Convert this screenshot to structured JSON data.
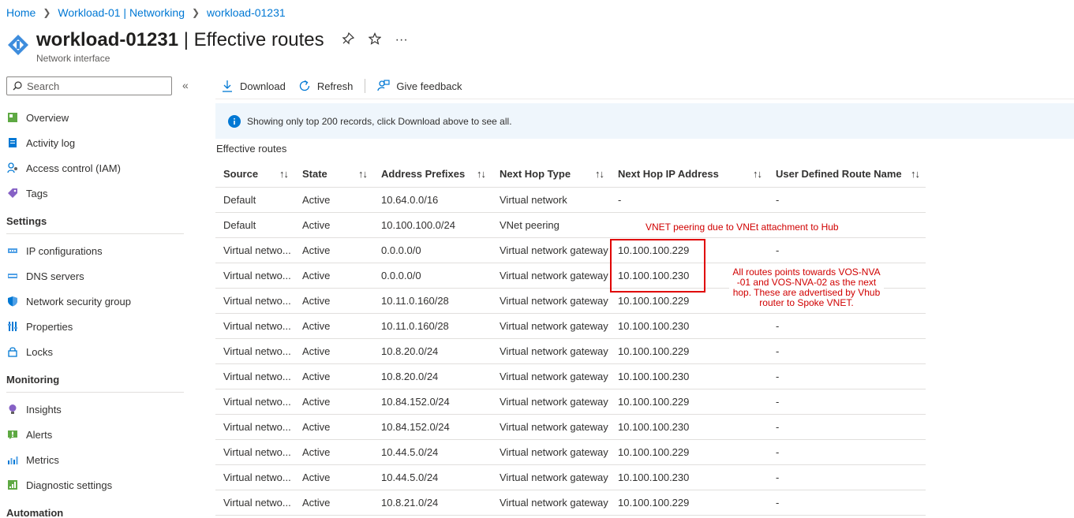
{
  "breadcrumb": {
    "items": [
      "Home",
      "Workload-01 | Networking",
      "workload-01231"
    ]
  },
  "header": {
    "name": "workload-01231",
    "separator": " | ",
    "section": "Effective routes",
    "subtitle": "Network interface"
  },
  "sidebar": {
    "search_placeholder": "Search",
    "items_top": [
      "Overview",
      "Activity log",
      "Access control (IAM)",
      "Tags"
    ],
    "settings_title": "Settings",
    "settings_items": [
      "IP configurations",
      "DNS servers",
      "Network security group",
      "Properties",
      "Locks"
    ],
    "monitoring_title": "Monitoring",
    "monitoring_items": [
      "Insights",
      "Alerts",
      "Metrics",
      "Diagnostic settings"
    ],
    "automation_title": "Automation"
  },
  "toolbar": {
    "download": "Download",
    "refresh": "Refresh",
    "feedback": "Give feedback"
  },
  "info": "Showing only top 200 records, click Download above to see all.",
  "section_label": "Effective routes",
  "table": {
    "headers": [
      "Source",
      "State",
      "Address Prefixes",
      "Next Hop Type",
      "Next Hop IP Address",
      "User Defined Route Name"
    ],
    "rows": [
      [
        "Default",
        "Active",
        "10.64.0.0/16",
        "Virtual network",
        "-",
        "-"
      ],
      [
        "Default",
        "Active",
        "10.100.100.0/24",
        "VNet peering",
        "",
        ""
      ],
      [
        "Virtual netwo...",
        "Active",
        "0.0.0.0/0",
        "Virtual network gateway",
        "10.100.100.229",
        "-"
      ],
      [
        "Virtual netwo...",
        "Active",
        "0.0.0.0/0",
        "Virtual network gateway",
        "10.100.100.230",
        ""
      ],
      [
        "Virtual netwo...",
        "Active",
        "10.11.0.160/28",
        "Virtual network gateway",
        "10.100.100.229",
        ""
      ],
      [
        "Virtual netwo...",
        "Active",
        "10.11.0.160/28",
        "Virtual network gateway",
        "10.100.100.230",
        "-"
      ],
      [
        "Virtual netwo...",
        "Active",
        "10.8.20.0/24",
        "Virtual network gateway",
        "10.100.100.229",
        "-"
      ],
      [
        "Virtual netwo...",
        "Active",
        "10.8.20.0/24",
        "Virtual network gateway",
        "10.100.100.230",
        "-"
      ],
      [
        "Virtual netwo...",
        "Active",
        "10.84.152.0/24",
        "Virtual network gateway",
        "10.100.100.229",
        "-"
      ],
      [
        "Virtual netwo...",
        "Active",
        "10.84.152.0/24",
        "Virtual network gateway",
        "10.100.100.230",
        "-"
      ],
      [
        "Virtual netwo...",
        "Active",
        "10.44.5.0/24",
        "Virtual network gateway",
        "10.100.100.229",
        "-"
      ],
      [
        "Virtual netwo...",
        "Active",
        "10.44.5.0/24",
        "Virtual network gateway",
        "10.100.100.230",
        "-"
      ],
      [
        "Virtual netwo...",
        "Active",
        "10.8.21.0/24",
        "Virtual network gateway",
        "10.100.100.229",
        "-"
      ]
    ]
  },
  "annotations": {
    "peering_note": "VNET peering due to VNEt attachment to Hub",
    "routes_note": "All routes points towards VOS-NVA -01 and VOS-NVA-02 as the next hop. These are advertised by Vhub router to Spoke VNET.",
    "color": "#e00000"
  },
  "colors": {
    "link": "#0078d4",
    "info_bg": "#eff6fc"
  }
}
